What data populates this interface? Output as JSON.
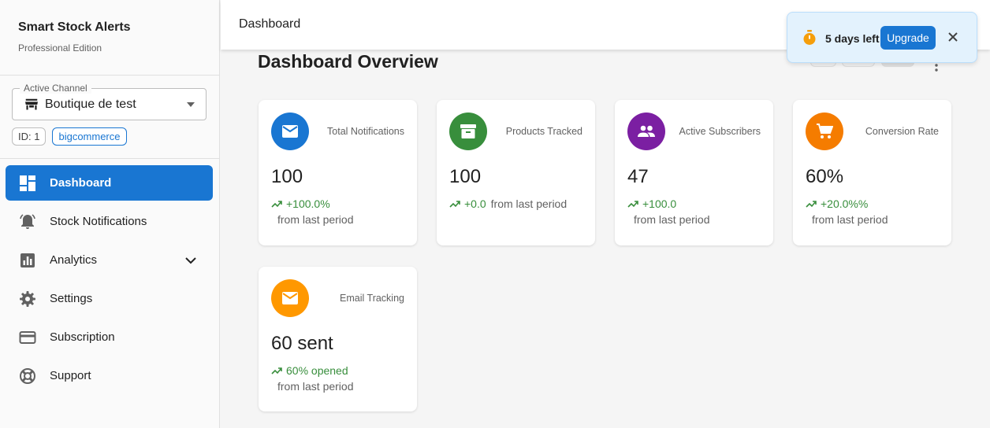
{
  "app": {
    "title": "Smart Stock Alerts",
    "edition": "Professional Edition"
  },
  "channel": {
    "legend": "Active Channel",
    "value": "Boutique de test",
    "id_chip": "ID: 1",
    "platform_chip": "bigcommerce"
  },
  "nav": {
    "items": [
      {
        "label": "Dashboard",
        "icon": "dashboard-icon",
        "active": true
      },
      {
        "label": "Stock Notifications",
        "icon": "bell-alert-icon"
      },
      {
        "label": "Analytics",
        "icon": "bar-chart-icon",
        "expandable": true
      },
      {
        "label": "Settings",
        "icon": "gear-icon"
      },
      {
        "label": "Subscription",
        "icon": "credit-card-icon"
      },
      {
        "label": "Support",
        "icon": "lifebuoy-icon"
      }
    ]
  },
  "topbar": {
    "title": "Dashboard"
  },
  "main": {
    "title": "Dashboard Overview"
  },
  "cards": [
    {
      "label": "Total Notifications",
      "value": "100",
      "trend": "+100.0%",
      "note": "from last period",
      "icon": "mail-icon",
      "color": "#1976d2"
    },
    {
      "label": "Products Tracked",
      "value": "100",
      "trend": "+0.0",
      "note": "from last period",
      "icon": "archive-icon",
      "color": "#388e3c"
    },
    {
      "label": "Active Subscribers",
      "value": "47",
      "trend": "+100.0",
      "note": "from last period",
      "icon": "people-icon",
      "color": "#7b1fa2"
    },
    {
      "label": "Conversion Rate",
      "value": "60%",
      "trend": "+20.0%%",
      "note": "from last period",
      "icon": "cart-icon",
      "color": "#f57c00"
    },
    {
      "label": "Email Tracking",
      "value": "60 sent",
      "trend": "60% opened",
      "note": "from last period",
      "icon": "mail-icon",
      "color": "#ff9800"
    }
  ],
  "toast": {
    "text": "5 days left",
    "button": "Upgrade"
  },
  "colors": {
    "primary": "#1976d2",
    "success": "#388e3c",
    "timer": "#f59e0b"
  }
}
